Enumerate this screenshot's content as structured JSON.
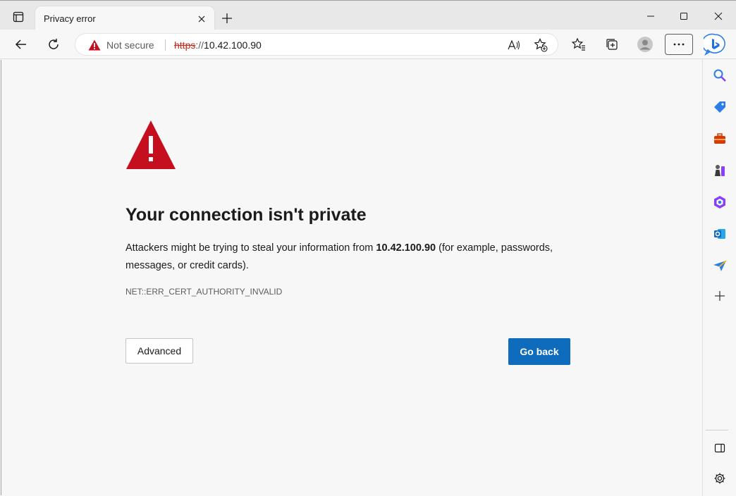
{
  "browser": {
    "tab": {
      "title": "Privacy error"
    },
    "address_bar": {
      "security_label": "Not secure",
      "url_scheme": "https",
      "url_separator": "://",
      "url_host": "10.42.100.90"
    },
    "colors": {
      "accent": "#0f6cbd",
      "danger": "#c50f1f"
    }
  },
  "error_page": {
    "heading": "Your connection isn't private",
    "message_prefix": "Attackers might be trying to steal your information from",
    "message_host": "10.42.100.90",
    "message_suffix": "(for example, passwords, messages, or credit cards).",
    "error_code": "NET::ERR_CERT_AUTHORITY_INVALID",
    "advanced_label": "Advanced",
    "go_back_label": "Go back"
  },
  "sidebar": {
    "items": [
      "search-icon",
      "tag-icon",
      "briefcase-icon",
      "games-icon",
      "office-icon",
      "outlook-icon",
      "send-icon",
      "plus-icon",
      "split-view-icon",
      "settings-icon"
    ]
  }
}
